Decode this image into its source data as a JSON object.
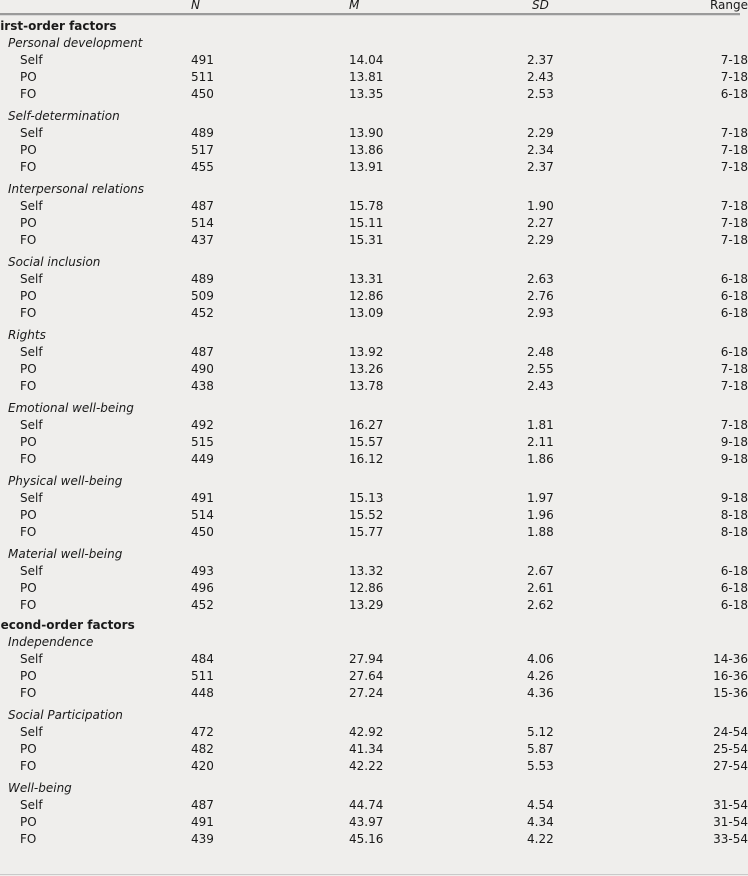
{
  "header": {
    "col_label": "",
    "col_n": "N",
    "col_m": "M",
    "col_sd": "SD",
    "col_range": "Range"
  },
  "sections": [
    {
      "title": "First-order factors",
      "groups": [
        {
          "title": "Personal development",
          "rows": [
            {
              "label": "Self",
              "n": "491",
              "m": "14.04",
              "sd": "2.37",
              "range": "7-18"
            },
            {
              "label": "PO",
              "n": "511",
              "m": "13.81",
              "sd": "2.43",
              "range": "7-18"
            },
            {
              "label": "FO",
              "n": "450",
              "m": "13.35",
              "sd": "2.53",
              "range": "6-18"
            }
          ]
        },
        {
          "title": "Self-determination",
          "rows": [
            {
              "label": "Self",
              "n": "489",
              "m": "13.90",
              "sd": "2.29",
              "range": "7-18"
            },
            {
              "label": "PO",
              "n": "517",
              "m": "13.86",
              "sd": "2.34",
              "range": "7-18"
            },
            {
              "label": "FO",
              "n": "455",
              "m": "13.91",
              "sd": "2.37",
              "range": "7-18"
            }
          ]
        },
        {
          "title": "Interpersonal relations",
          "rows": [
            {
              "label": "Self",
              "n": "487",
              "m": "15.78",
              "sd": "1.90",
              "range": "7-18"
            },
            {
              "label": "PO",
              "n": "514",
              "m": "15.11",
              "sd": "2.27",
              "range": "7-18"
            },
            {
              "label": "FO",
              "n": "437",
              "m": "15.31",
              "sd": "2.29",
              "range": "7-18"
            }
          ]
        },
        {
          "title": "Social inclusion",
          "rows": [
            {
              "label": "Self",
              "n": "489",
              "m": "13.31",
              "sd": "2.63",
              "range": "6-18"
            },
            {
              "label": "PO",
              "n": "509",
              "m": "12.86",
              "sd": "2.76",
              "range": "6-18"
            },
            {
              "label": "FO",
              "n": "452",
              "m": "13.09",
              "sd": "2.93",
              "range": "6-18"
            }
          ]
        },
        {
          "title": "Rights",
          "rows": [
            {
              "label": "Self",
              "n": "487",
              "m": "13.92",
              "sd": "2.48",
              "range": "6-18"
            },
            {
              "label": "PO",
              "n": "490",
              "m": "13.26",
              "sd": "2.55",
              "range": "7-18"
            },
            {
              "label": "FO",
              "n": "438",
              "m": "13.78",
              "sd": "2.43",
              "range": "7-18"
            }
          ]
        },
        {
          "title": "Emotional well-being",
          "rows": [
            {
              "label": "Self",
              "n": "492",
              "m": "16.27",
              "sd": "1.81",
              "range": "7-18"
            },
            {
              "label": "PO",
              "n": "515",
              "m": "15.57",
              "sd": "2.11",
              "range": "9-18"
            },
            {
              "label": "FO",
              "n": "449",
              "m": "16.12",
              "sd": "1.86",
              "range": "9-18"
            }
          ]
        },
        {
          "title": "Physical well-being",
          "rows": [
            {
              "label": "Self",
              "n": "491",
              "m": "15.13",
              "sd": "1.97",
              "range": "9-18"
            },
            {
              "label": "PO",
              "n": "514",
              "m": "15.52",
              "sd": "1.96",
              "range": "8-18"
            },
            {
              "label": "FO",
              "n": "450",
              "m": "15.77",
              "sd": "1.88",
              "range": "8-18"
            }
          ]
        },
        {
          "title": "Material well-being",
          "rows": [
            {
              "label": "Self",
              "n": "493",
              "m": "13.32",
              "sd": "2.67",
              "range": "6-18"
            },
            {
              "label": "PO",
              "n": "496",
              "m": "12.86",
              "sd": "2.61",
              "range": "6-18"
            },
            {
              "label": "FO",
              "n": "452",
              "m": "13.29",
              "sd": "2.62",
              "range": "6-18"
            }
          ]
        }
      ]
    },
    {
      "title": "Second-order factors",
      "groups": [
        {
          "title": "Independence",
          "rows": [
            {
              "label": "Self",
              "n": "484",
              "m": "27.94",
              "sd": "4.06",
              "range": "14-36"
            },
            {
              "label": "PO",
              "n": "511",
              "m": "27.64",
              "sd": "4.26",
              "range": "16-36"
            },
            {
              "label": "FO",
              "n": "448",
              "m": "27.24",
              "sd": "4.36",
              "range": "15-36"
            }
          ]
        },
        {
          "title": "Social Participation",
          "rows": [
            {
              "label": "Self",
              "n": "472",
              "m": "42.92",
              "sd": "5.12",
              "range": "24-54"
            },
            {
              "label": "PO",
              "n": "482",
              "m": "41.34",
              "sd": "5.87",
              "range": "25-54"
            },
            {
              "label": "FO",
              "n": "420",
              "m": "42.22",
              "sd": "5.53",
              "range": "27-54"
            }
          ]
        },
        {
          "title": "Well-being",
          "rows": [
            {
              "label": "Self",
              "n": "487",
              "m": "44.74",
              "sd": "4.54",
              "range": "31-54"
            },
            {
              "label": "PO",
              "n": "491",
              "m": "43.97",
              "sd": "4.34",
              "range": "31-54"
            },
            {
              "label": "FO",
              "n": "439",
              "m": "45.16",
              "sd": "4.22",
              "range": "33-54"
            }
          ]
        }
      ]
    }
  ]
}
